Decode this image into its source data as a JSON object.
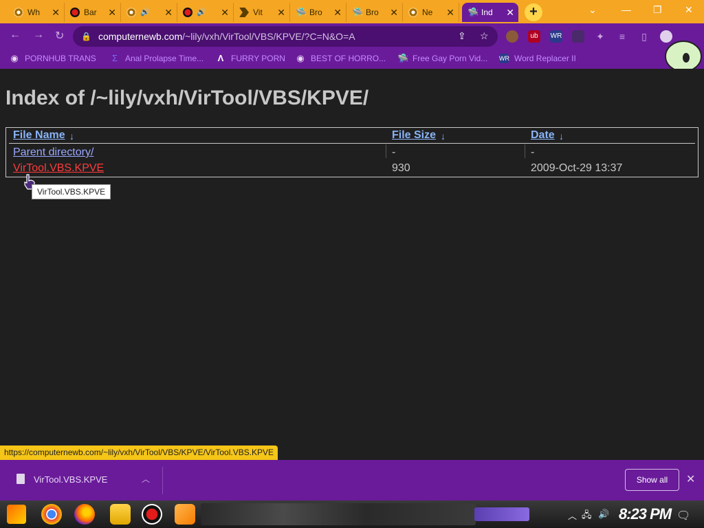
{
  "tabs": [
    {
      "title": "Wh",
      "icon": "chrome-icon"
    },
    {
      "title": "Bar",
      "icon": "record-icon"
    },
    {
      "title": "",
      "icon": "chrome-icon"
    },
    {
      "title": "",
      "icon": "record-icon"
    },
    {
      "title": "Vit",
      "icon": "arrow-icon"
    },
    {
      "title": "Bro",
      "icon": "ufo-icon"
    },
    {
      "title": "Bro",
      "icon": "ufo-icon"
    },
    {
      "title": "Ne",
      "icon": "chrome-icon"
    },
    {
      "title": "Ind",
      "icon": "ufo-icon"
    }
  ],
  "url": {
    "host": "computernewb.com",
    "path": "/~lily/vxh/VirTool/VBS/KPVE/?C=N&O=A"
  },
  "bookmarks": [
    {
      "label": "PORNHUB TRANS"
    },
    {
      "label": "Anal Prolapse Time..."
    },
    {
      "label": "FURRY PORN"
    },
    {
      "label": "BEST OF HORRO..."
    },
    {
      "label": "Free Gay Porn Vid..."
    },
    {
      "label": "Word Replacer II"
    }
  ],
  "page": {
    "title": "Index of /~lily/vxh/VirTool/VBS/KPVE/",
    "headers": {
      "name": "File Name",
      "size": "File Size",
      "date": "Date",
      "sort_glyph": "↓"
    },
    "rows": [
      {
        "name": "Parent directory/",
        "size": "-",
        "date": "-"
      },
      {
        "name": "VirTool.VBS.KPVE",
        "size": "930",
        "date": "2009-Oct-29 13:37"
      }
    ],
    "tooltip": "VirTool.VBS.KPVE"
  },
  "status_url": "https://computernewb.com/~lily/vxh/VirTool/VBS/KPVE/VirTool.VBS.KPVE",
  "download": {
    "filename": "VirTool.VBS.KPVE",
    "show_all": "Show all"
  },
  "taskbar": {
    "clock": "8:23 PM"
  },
  "colors": {
    "accent": "#6a1b9a",
    "tab_strip": "#f5a623",
    "link": "#9aa8ff",
    "active_link": "#ff3b3b"
  }
}
